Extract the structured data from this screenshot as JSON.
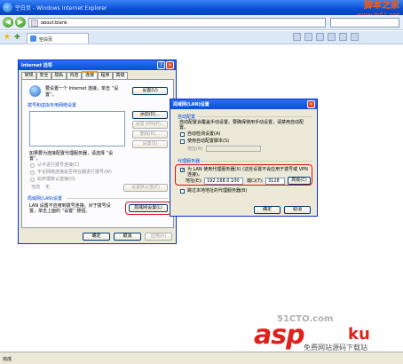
{
  "browser": {
    "title": "空白页 - Windows Internet Explorer",
    "address": "about:blank",
    "tab_label": "空白页",
    "status": "完成",
    "back_glyph": "◀",
    "forward_glyph": "▶",
    "favorites_glyph": "★",
    "add_fav_glyph": "✚"
  },
  "brand": {
    "name": "脚本之家",
    "url": "www.Jb51.net"
  },
  "watermark": {
    "num": "51CTO.com",
    "main": "asp",
    "ku": "ku",
    "sub": "免费网站源码下载站"
  },
  "internet_options": {
    "title": "Internet 选项",
    "help_glyph": "?",
    "close_glyph": "×",
    "tabs": [
      "常规",
      "安全",
      "隐私",
      "内容",
      "连接",
      "程序",
      "高级"
    ],
    "active_tab": "连接",
    "setup_text_1": "要设置一个 Internet 连接，单击 “设",
    "setup_text_2": "置”。",
    "setup_button": "设置(U)",
    "dialup_group": "拨号和虚拟专用网络设置",
    "add_button": "添加(D)...",
    "add_vpn_button": "添加 VPN(P)...",
    "delete_button": "删除(R)...",
    "settings_button": "设置(S)",
    "proxy_hint_1": "如果要为连接配置代理服务器，请选择 “设",
    "proxy_hint_2": "置”。",
    "radio_never": "从不进行拨号连接(C)",
    "radio_no_network": "不论网络连接是否存在都进行拨号(W)",
    "radio_always": "始终拨默认连接(O)",
    "current_label": "当前",
    "current_value": "无",
    "default_button": "设置默认值(E)",
    "lan_group": "局域网(LAN)设置",
    "lan_text_1": "LAN 设置不应用到拨号连接。对于拨号设",
    "lan_text_2": "置，单击上面的 “设置” 按钮。",
    "lan_button": "局域网设置(L)",
    "ok": "确定",
    "cancel": "取消",
    "apply": "应用(A)"
  },
  "lan_dialog": {
    "title": "局域网(LAN)设置",
    "close_glyph": "×",
    "check_glyph": "✓",
    "auto_group": "自动配置",
    "auto_desc_1": "自动配置会覆盖手动设置。要确保使用手动设置，请禁用自动配",
    "auto_desc_2": "置。",
    "auto_detect": "自动检测设置(A)",
    "use_script": "使用自动配置脚本(S)",
    "address_label": "地址(R)",
    "proxy_group": "代理服务器",
    "use_proxy_1": "为 LAN 使用代理服务器(X) (这些设置不会应用于拨号或 VPN",
    "use_proxy_2": "连接)。",
    "addr_label": "地址(E):",
    "addr_value": "192.168.0.100",
    "port_label": "端口(T):",
    "port_value": "3128",
    "advanced_button": "高级(C)",
    "bypass_local": "跳过本地地址的代理服务器(B)",
    "ok": "确定",
    "cancel": "取消"
  },
  "colors": {
    "accent": "#0a4fd8",
    "highlight": "#e01010",
    "dialog_bg": "#ece9d8"
  }
}
